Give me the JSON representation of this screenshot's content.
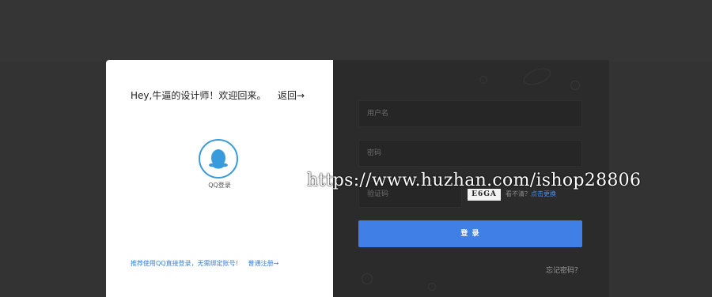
{
  "colors": {
    "background": "#333333",
    "panel": "#2b2b2b",
    "accent": "#3f7fe6",
    "qq_blue": "#3a9bdc",
    "link": "#3a7fd5"
  },
  "card": {
    "title": "Hey,牛逼的设计师！欢迎回来。",
    "back_label": "返回→",
    "qq_icon": "qq-penguin-icon",
    "qq_label": "QQ登录",
    "recommend_text": "推荐使用QQ直接登录，无需绑定账号！",
    "register_label": "普通注册→"
  },
  "form": {
    "username_placeholder": "用户名",
    "password_placeholder": "密码",
    "captcha_placeholder": "验证码",
    "captcha_text": "E6GA",
    "captcha_hint": "看不清？",
    "captcha_refresh": "点击更换",
    "login_label": "登 录",
    "forgot_label": "忘记密码？"
  },
  "watermark": "https://www.huzhan.com/ishop28806"
}
